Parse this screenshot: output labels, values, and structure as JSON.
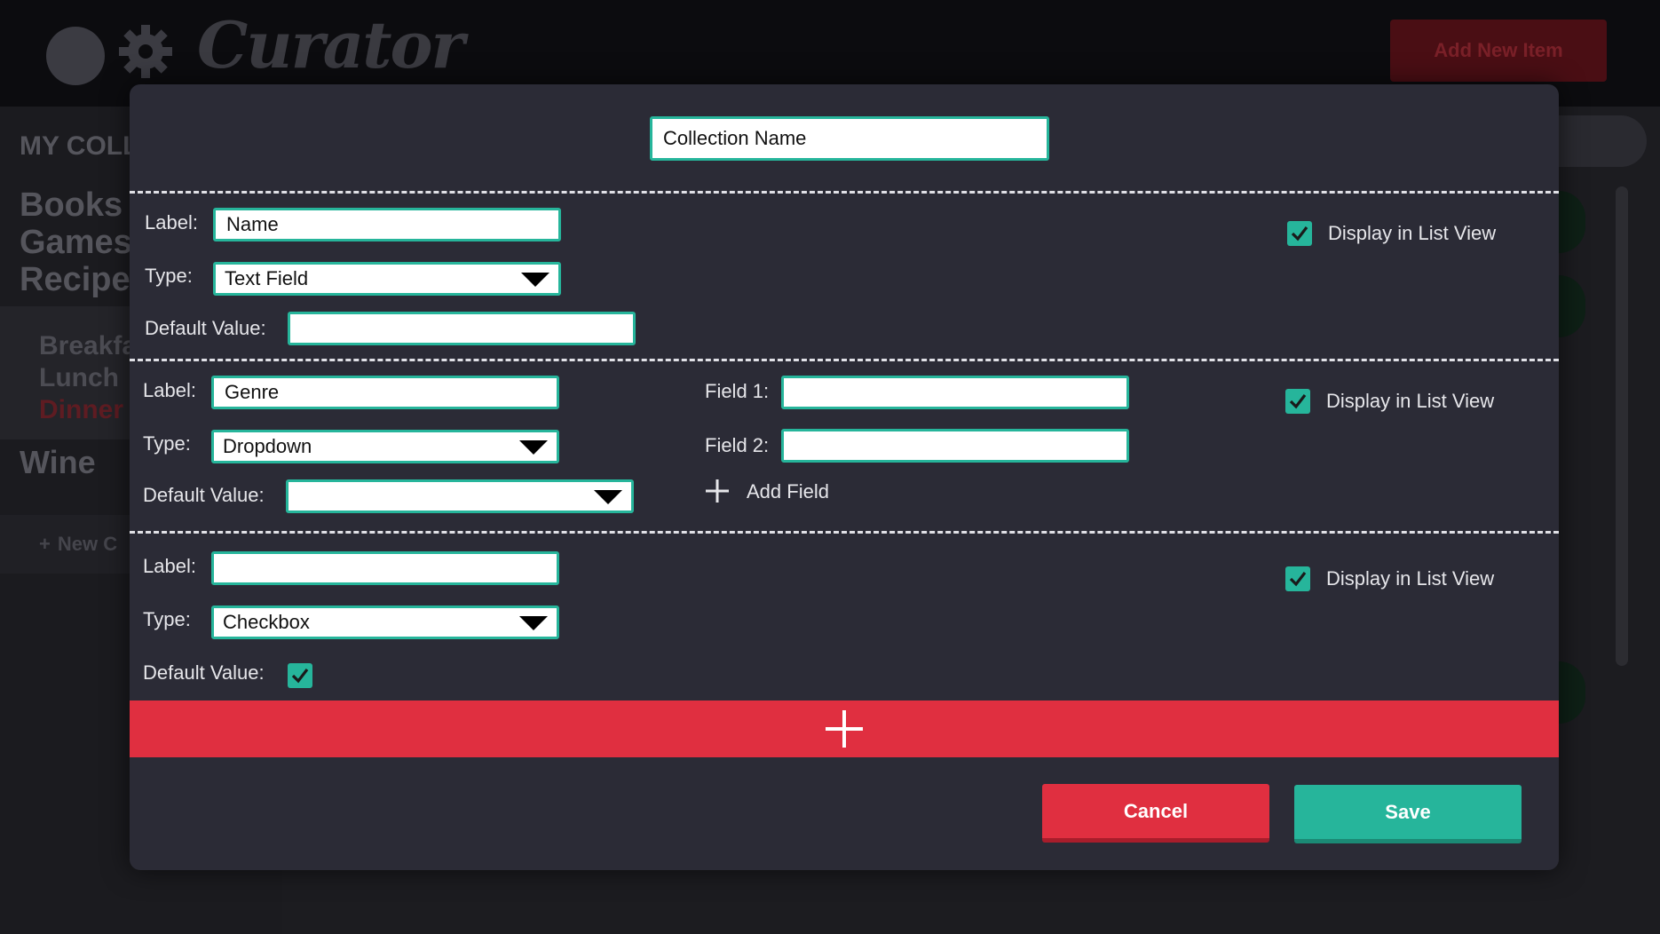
{
  "app": {
    "logo_text": "Curator",
    "add_new_item_label": "Add New Item"
  },
  "sidebar": {
    "title": "MY COLL",
    "collections": [
      "Books",
      "Games",
      "Recipes"
    ],
    "recipe_subitems": [
      "Breakfa",
      "Lunch",
      "Dinner"
    ],
    "wine": "Wine",
    "new_collection_label": "New C"
  },
  "modal": {
    "collection_name_value": "Collection Name",
    "fields": [
      {
        "label_caption": "Label:",
        "label_value": "Name",
        "type_caption": "Type:",
        "type_value": "Text Field",
        "default_caption": "Default Value:",
        "default_value": "",
        "display_in_list_view": "Display in List View",
        "display_checked": true
      },
      {
        "label_caption": "Label:",
        "label_value": "Genre",
        "type_caption": "Type:",
        "type_value": "Dropdown",
        "default_caption": "Default Value:",
        "default_value": "",
        "option_fields": [
          {
            "caption": "Field 1:",
            "value": ""
          },
          {
            "caption": "Field 2:",
            "value": ""
          }
        ],
        "add_field_label": "Add Field",
        "display_in_list_view": "Display in List View",
        "display_checked": true
      },
      {
        "label_caption": "Label:",
        "label_value": "",
        "type_caption": "Type:",
        "type_value": "Checkbox",
        "default_caption": "Default Value:",
        "default_checked": true,
        "display_in_list_view": "Display in List View",
        "display_checked": true
      }
    ],
    "cancel_label": "Cancel",
    "save_label": "Save"
  },
  "colors": {
    "accent_teal": "#26b59b",
    "danger_red": "#e02f40",
    "modal_bg": "#2b2b36"
  }
}
